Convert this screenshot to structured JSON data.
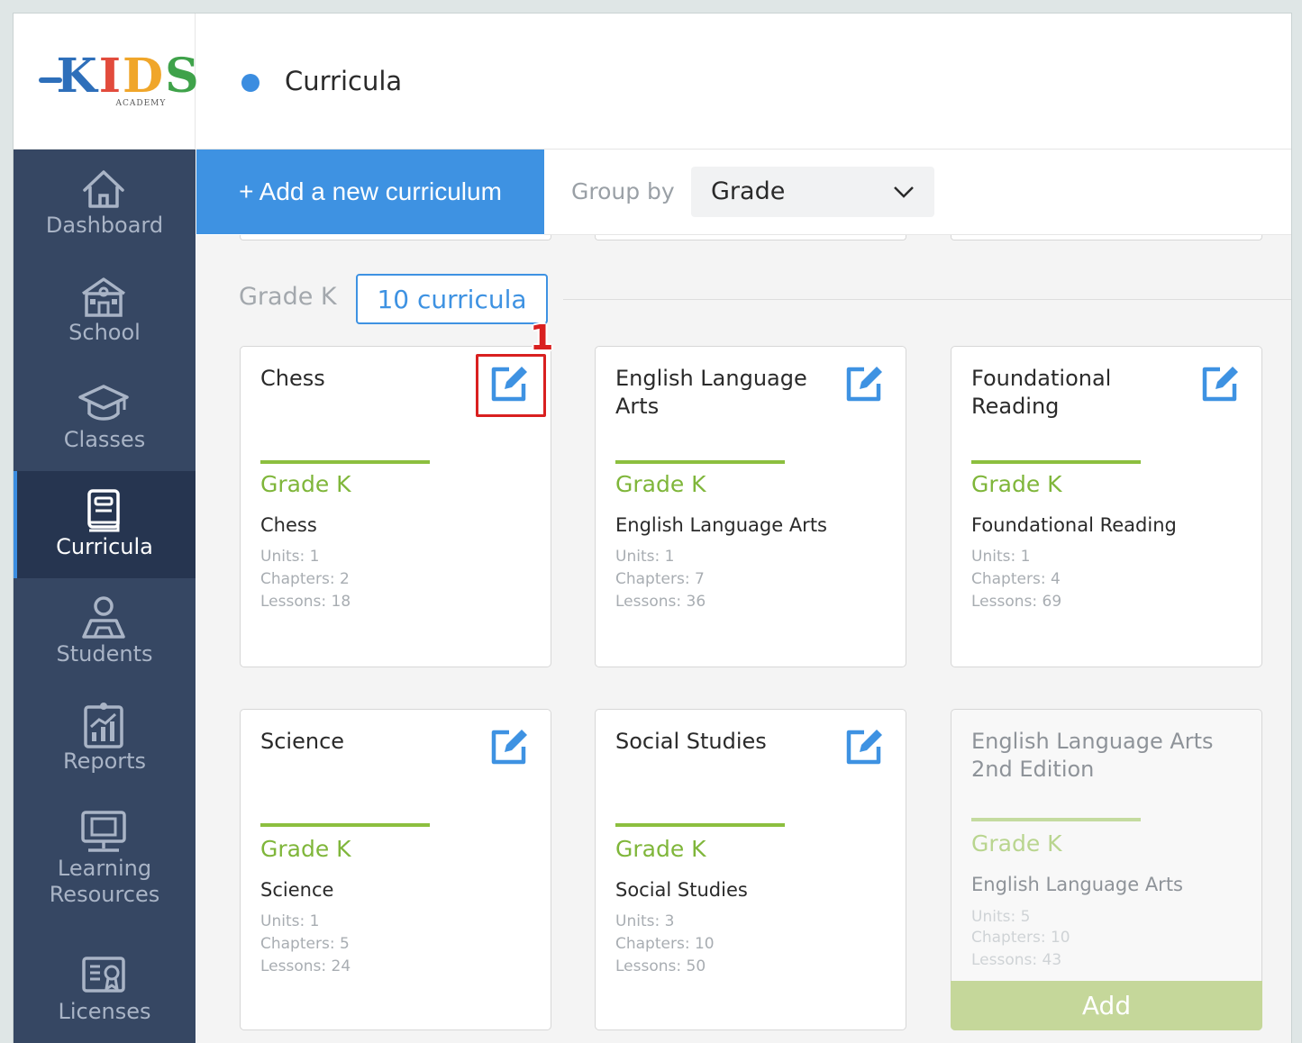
{
  "logo": {
    "letters": [
      "K",
      "I",
      "D",
      "S"
    ],
    "subtitle": "ACADEMY"
  },
  "header": {
    "title": "Curricula"
  },
  "sidebar": {
    "items": [
      {
        "label": "Dashboard",
        "icon": "home-icon"
      },
      {
        "label": "School",
        "icon": "school-icon"
      },
      {
        "label": "Classes",
        "icon": "graduation-cap-icon"
      },
      {
        "label": "Curricula",
        "icon": "book-icon",
        "active": true
      },
      {
        "label": "Students",
        "icon": "student-icon"
      },
      {
        "label": "Reports",
        "icon": "report-chart-icon"
      },
      {
        "label_line1": "Learning",
        "label_line2": "Resources",
        "icon": "monitor-icon"
      },
      {
        "label": "Licenses",
        "icon": "certificate-icon"
      }
    ]
  },
  "toolbar": {
    "add_label": "+ Add a new curriculum",
    "group_by_label": "Group by",
    "group_by_value": "Grade"
  },
  "group": {
    "label": "Grade K",
    "count_label": "10 curricula"
  },
  "annotation": {
    "callout": "1"
  },
  "cards": [
    {
      "title": "Chess",
      "grade": "Grade K",
      "subject": "Chess",
      "units": "Units: 1",
      "chapters": "Chapters: 2",
      "lessons": "Lessons: 18"
    },
    {
      "title": "English Language Arts",
      "grade": "Grade K",
      "subject": "English Language Arts",
      "units": "Units: 1",
      "chapters": "Chapters: 7",
      "lessons": "Lessons: 36"
    },
    {
      "title": "Foundational Reading",
      "grade": "Grade K",
      "subject": "Foundational Reading",
      "units": "Units: 1",
      "chapters": "Chapters: 4",
      "lessons": "Lessons: 69"
    },
    {
      "title": "Science",
      "grade": "Grade K",
      "subject": "Science",
      "units": "Units: 1",
      "chapters": "Chapters: 5",
      "lessons": "Lessons: 24"
    },
    {
      "title": "Social Studies",
      "grade": "Grade K",
      "subject": "Social Studies",
      "units": "Units: 3",
      "chapters": "Chapters: 10",
      "lessons": "Lessons: 50"
    },
    {
      "title": "English Language Arts 2nd Edition",
      "grade": "Grade K",
      "subject": "English Language Arts",
      "units": "Units: 5",
      "chapters": "Chapters: 10",
      "lessons": "Lessons: 43",
      "add_label": "Add"
    }
  ],
  "colors": {
    "accent": "#3e92e2",
    "sidebar": "#364763",
    "grade_green": "#7fb63a",
    "highlight_red": "#d92020"
  }
}
